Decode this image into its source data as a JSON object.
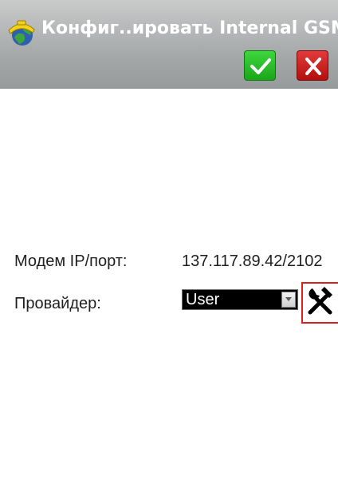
{
  "window": {
    "title": "Конфиг..ировать Internal GSM"
  },
  "toolbar": {
    "ok_icon": "check-icon",
    "cancel_icon": "close-icon"
  },
  "form": {
    "modem_label": "Модем IP/порт:",
    "modem_value": "137.117.89.42/2102",
    "provider_label": "Провайдер:",
    "provider_selected": "User",
    "provider_tools_icon": "tools-icon"
  },
  "colors": {
    "ok_green": "#22b822",
    "cancel_red": "#c81818",
    "highlight_red": "#d81e1e"
  }
}
